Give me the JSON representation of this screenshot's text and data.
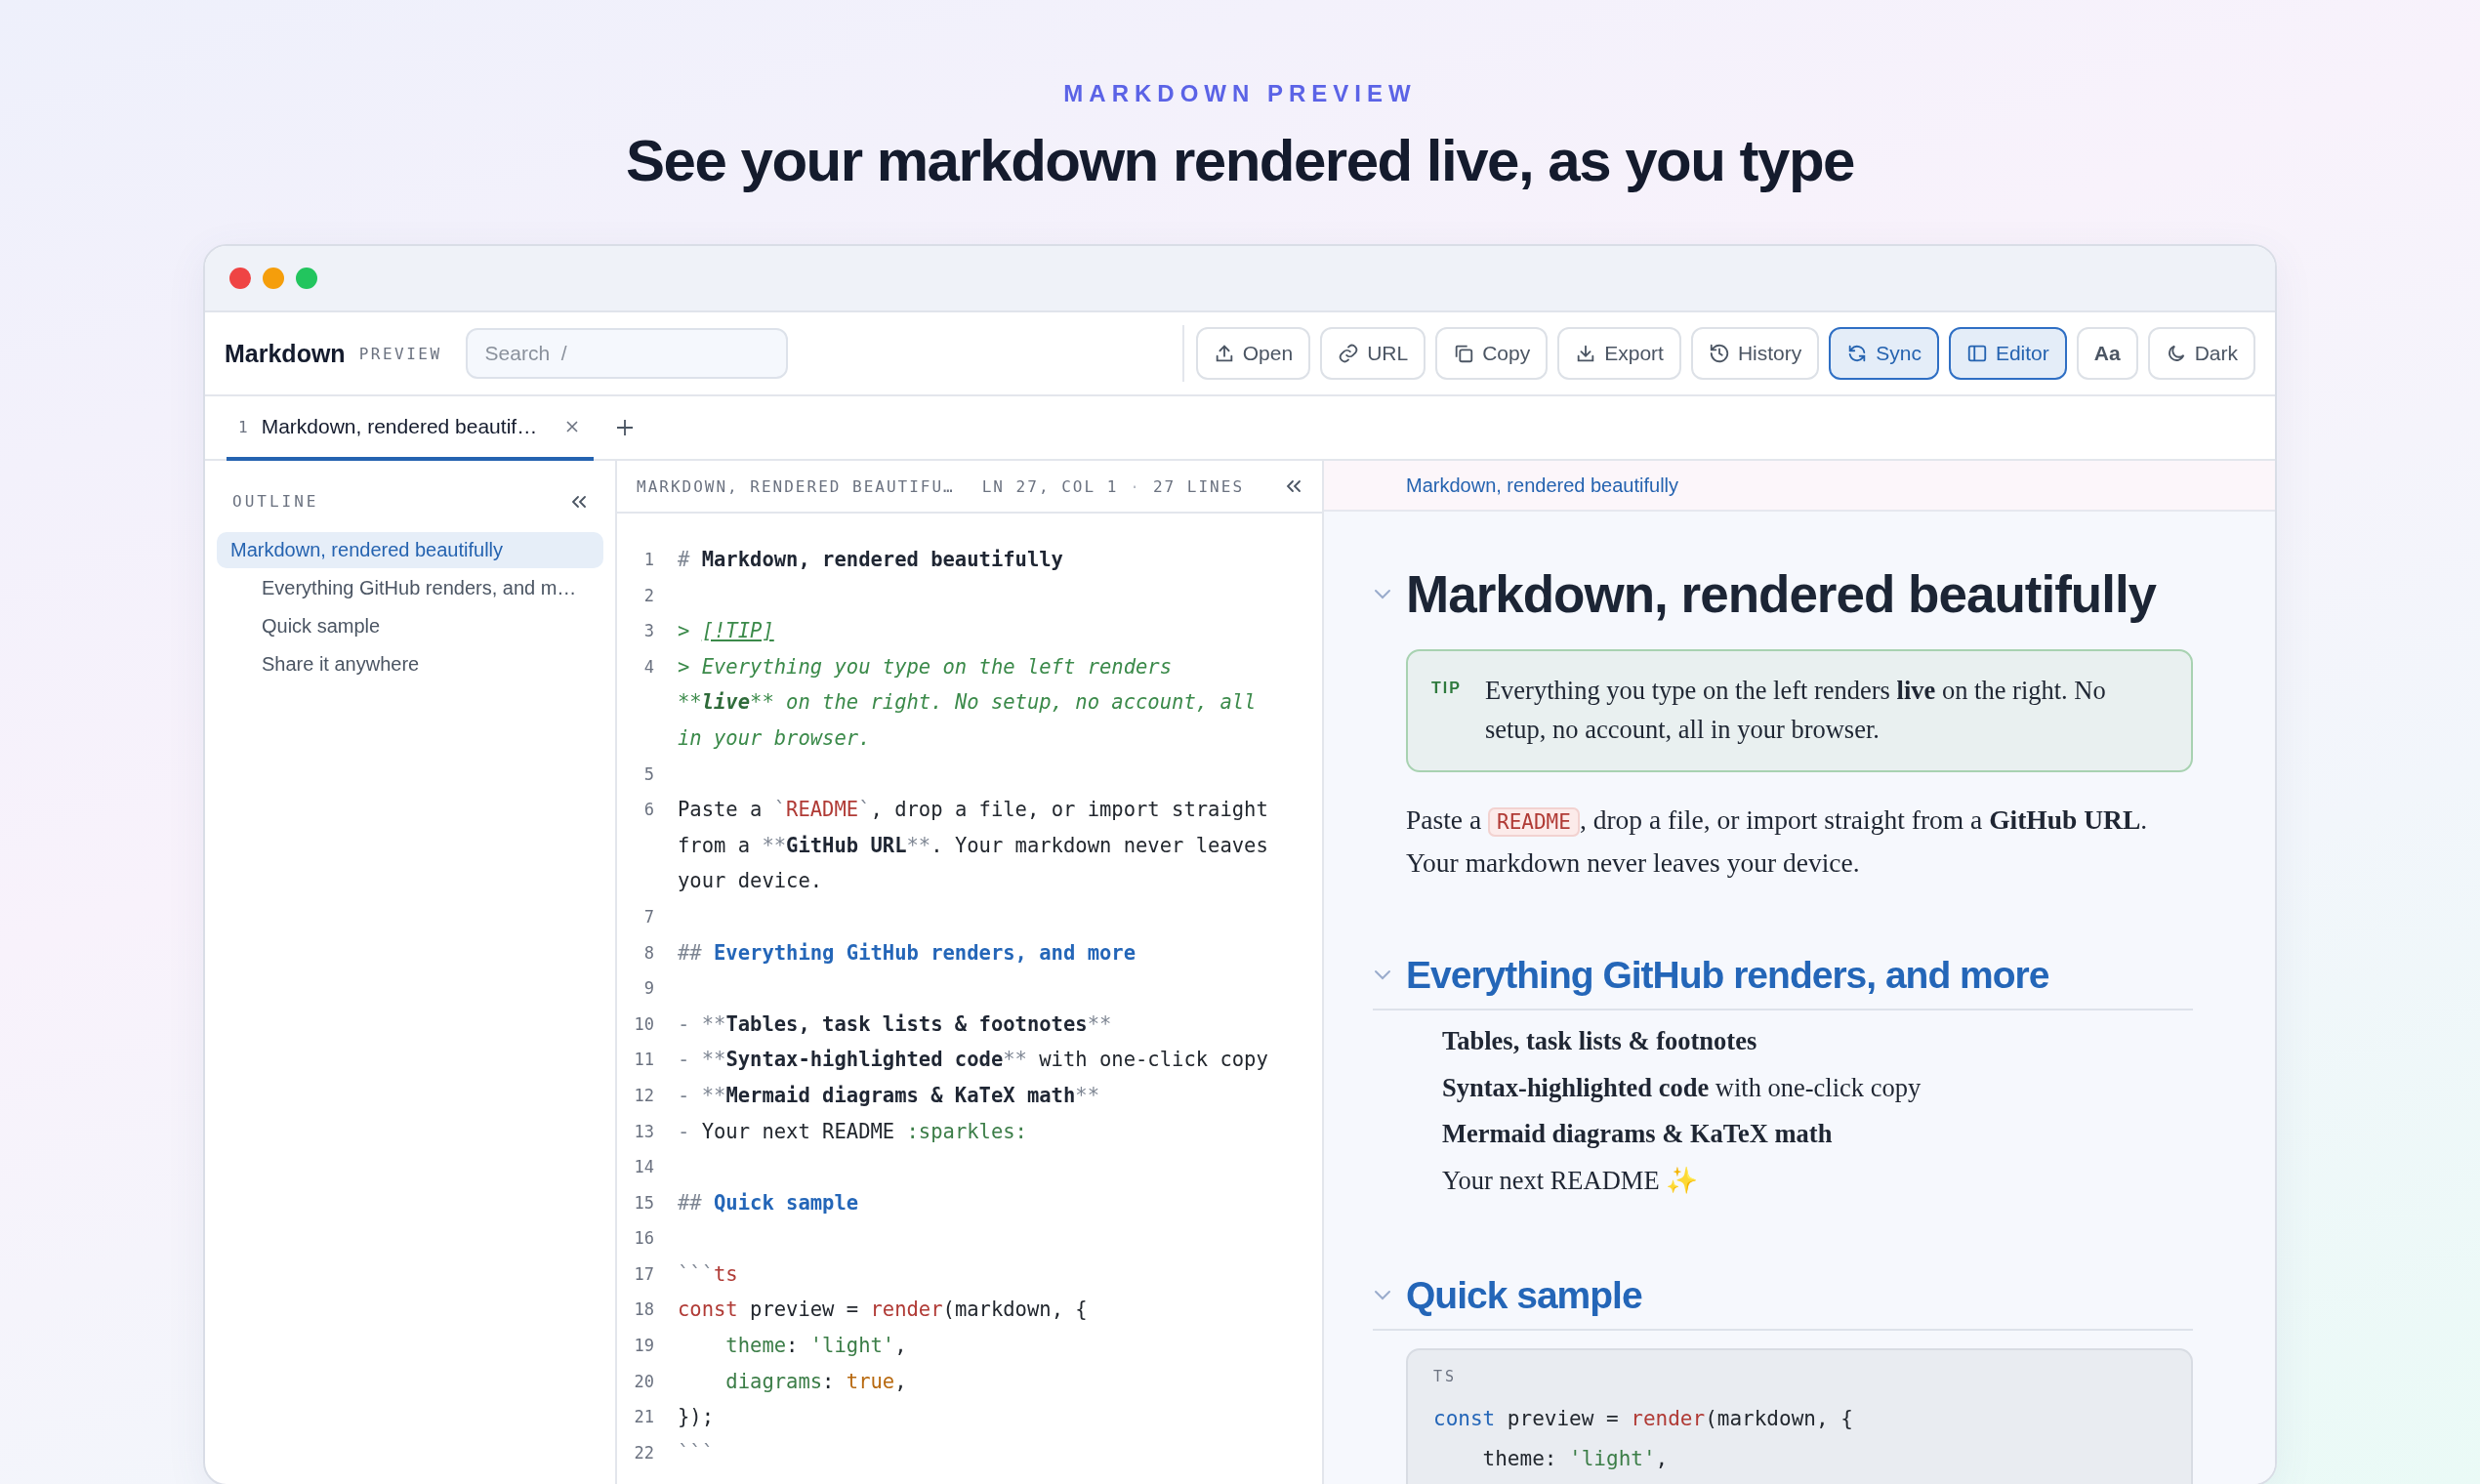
{
  "hero": {
    "eyebrow": "MARKDOWN PREVIEW",
    "headline": "See your markdown rendered live, as you type"
  },
  "toolbar": {
    "brand": "Markdown",
    "brand_tag": "PREVIEW",
    "search": {
      "placeholder": "Search  /"
    },
    "buttons": [
      {
        "label": "Open",
        "on": false
      },
      {
        "label": "URL",
        "on": false
      },
      {
        "label": "Copy",
        "on": false
      },
      {
        "label": "Export",
        "on": false
      },
      {
        "label": "History",
        "on": false
      },
      {
        "label": "Sync",
        "on": true
      },
      {
        "label": "Editor",
        "on": true
      },
      {
        "label": "Aa",
        "on": false
      },
      {
        "label": "Dark",
        "on": false
      }
    ]
  },
  "tabs": [
    {
      "number": "1",
      "title": "Markdown, rendered beautif…",
      "selected": true
    }
  ],
  "outline": {
    "title": "OUTLINE",
    "items": [
      {
        "label": "Markdown, rendered beautifully",
        "selected": true,
        "children": [
          {
            "label": "Everything GitHub renders, and m…",
            "selected": false
          },
          {
            "label": "Quick sample",
            "selected": false
          },
          {
            "label": "Share it anywhere",
            "selected": false
          }
        ]
      }
    ]
  },
  "editor": {
    "file": "MARKDOWN, RENDERED BEAUTIFU…",
    "position": "LN 27, COL 1",
    "separator": "·",
    "line_count": "27 LINES",
    "lines": [
      {
        "number": "1",
        "rows": [
          {
            "indented": false,
            "segments": [
              {
                "text": "# ",
                "kind": "marker"
              },
              {
                "text": "Markdown, rendered beautifully",
                "kind": "bold"
              }
            ]
          }
        ]
      },
      {
        "number": "2"
      },
      {
        "number": "3",
        "rows": [
          {
            "indented": false,
            "segments": [
              {
                "text": "> ",
                "kind": "quote"
              },
              {
                "text": "[!TIP]",
                "kind": "link"
              }
            ]
          }
        ]
      },
      {
        "number": "4",
        "rows": [
          {
            "indented": false,
            "segments": [
              {
                "text": "> Everything you type on the left renders",
                "kind": "quote"
              }
            ]
          },
          {
            "indented": false,
            "segments": [
              {
                "text": "**",
                "kind": "quote"
              },
              {
                "text": "live",
                "kind": "quote-bold"
              },
              {
                "text": "** on the right. No setup, no account, all",
                "kind": "quote"
              }
            ]
          },
          {
            "indented": false,
            "segments": [
              {
                "text": "in your browser.",
                "kind": "quote"
              }
            ]
          }
        ]
      },
      {
        "number": "5"
      },
      {
        "number": "6",
        "rows": [
          {
            "indented": false,
            "segments": [
              {
                "text": "Paste a ",
                "kind": "plain"
              },
              {
                "text": "`",
                "kind": "marker"
              },
              {
                "text": "README",
                "kind": "code"
              },
              {
                "text": "`",
                "kind": "marker"
              },
              {
                "text": ", drop a file, or import straight",
                "kind": "plain"
              }
            ]
          },
          {
            "indented": false,
            "segments": [
              {
                "text": "from a ",
                "kind": "plain"
              },
              {
                "text": "**",
                "kind": "marker"
              },
              {
                "text": "GitHub URL",
                "kind": "bold"
              },
              {
                "text": "**",
                "kind": "marker"
              },
              {
                "text": ". Your markdown never leaves",
                "kind": "plain"
              }
            ]
          },
          {
            "indented": false,
            "segments": [
              {
                "text": "your device.",
                "kind": "plain"
              }
            ]
          }
        ]
      },
      {
        "number": "7"
      },
      {
        "number": "8",
        "rows": [
          {
            "indented": false,
            "segments": [
              {
                "text": "## ",
                "kind": "marker"
              },
              {
                "text": "Everything GitHub renders, and more",
                "kind": "heading"
              }
            ]
          }
        ]
      },
      {
        "number": "9"
      },
      {
        "number": "10",
        "rows": [
          {
            "indented": false,
            "segments": [
              {
                "text": "- **",
                "kind": "marker"
              },
              {
                "text": "Tables, task lists & footnotes",
                "kind": "bold"
              },
              {
                "text": "**",
                "kind": "marker"
              }
            ]
          }
        ]
      },
      {
        "number": "11",
        "rows": [
          {
            "indented": false,
            "segments": [
              {
                "text": "- **",
                "kind": "marker"
              },
              {
                "text": "Syntax-highlighted code",
                "kind": "bold"
              },
              {
                "text": "**",
                "kind": "marker"
              },
              {
                "text": " with one-click copy",
                "kind": "plain"
              }
            ]
          }
        ]
      },
      {
        "number": "12",
        "rows": [
          {
            "indented": false,
            "segments": [
              {
                "text": "- **",
                "kind": "marker"
              },
              {
                "text": "Mermaid diagrams & KaTeX math",
                "kind": "bold"
              },
              {
                "text": "**",
                "kind": "marker"
              }
            ]
          }
        ]
      },
      {
        "number": "13",
        "rows": [
          {
            "indented": false,
            "segments": [
              {
                "text": "- ",
                "kind": "marker"
              },
              {
                "text": "Your next README ",
                "kind": "plain"
              },
              {
                "text": ":sparkles:",
                "kind": "emoji"
              }
            ]
          }
        ]
      },
      {
        "number": "14"
      },
      {
        "number": "15",
        "rows": [
          {
            "indented": false,
            "segments": [
              {
                "text": "## ",
                "kind": "marker"
              },
              {
                "text": "Quick sample",
                "kind": "heading"
              }
            ]
          }
        ]
      },
      {
        "number": "16"
      },
      {
        "number": "17",
        "rows": [
          {
            "indented": false,
            "segments": [
              {
                "text": "```",
                "kind": "marker"
              },
              {
                "text": "ts",
                "kind": "code"
              }
            ]
          }
        ]
      },
      {
        "number": "18",
        "rows": [
          {
            "indented": false,
            "segments": [
              {
                "text": "const",
                "kind": "keyword"
              },
              {
                "text": " preview = ",
                "kind": "plain"
              },
              {
                "text": "render",
                "kind": "func"
              },
              {
                "text": "(markdown, {",
                "kind": "plain"
              }
            ]
          }
        ]
      },
      {
        "number": "19",
        "rows": [
          {
            "indented": true,
            "segments": [
              {
                "text": "theme",
                "kind": "key"
              },
              {
                "text": ": ",
                "kind": "plain"
              },
              {
                "text": "'light'",
                "kind": "string"
              },
              {
                "text": ",",
                "kind": "plain"
              }
            ]
          }
        ]
      },
      {
        "number": "20",
        "rows": [
          {
            "indented": true,
            "segments": [
              {
                "text": "diagrams",
                "kind": "key"
              },
              {
                "text": ": ",
                "kind": "plain"
              },
              {
                "text": "true",
                "kind": "bool"
              },
              {
                "text": ",",
                "kind": "plain"
              }
            ]
          }
        ]
      },
      {
        "number": "21",
        "rows": [
          {
            "indented": false,
            "segments": [
              {
                "text": "});",
                "kind": "plain"
              }
            ]
          }
        ]
      },
      {
        "number": "22",
        "rows": [
          {
            "indented": false,
            "segments": [
              {
                "text": "```",
                "kind": "marker"
              }
            ]
          }
        ]
      }
    ]
  },
  "preview": {
    "breadcrumb": "Markdown, rendered beautifully",
    "blocks": [
      {
        "kind": "title",
        "text": "Markdown, rendered beautifully"
      },
      {
        "kind": "callout",
        "label": "TIP",
        "text": "Everything you type on the left renders **live** on the right. No setup, no account, all in your browser."
      },
      {
        "kind": "paragraph",
        "segments": [
          {
            "text": "Paste a ",
            "kind": "plain"
          },
          {
            "text": "README",
            "kind": "code"
          },
          {
            "text": ", drop a file, or import straight from a ",
            "kind": "plain"
          },
          {
            "text": "GitHub URL",
            "kind": "bold"
          },
          {
            "text": ". Your markdown never leaves your device.",
            "kind": "plain"
          }
        ]
      },
      {
        "kind": "heading",
        "text": "Everything GitHub renders, and more"
      },
      {
        "kind": "list",
        "items": [
          {
            "text": "**Tables, task lists & footnotes**"
          },
          {
            "text": "**Syntax-highlighted code** with one-click copy"
          },
          {
            "text": "**Mermaid diagrams & KaTeX math**"
          },
          {
            "text": "Your next README ✨"
          }
        ]
      },
      {
        "kind": "heading",
        "text": "Quick sample"
      },
      {
        "kind": "code",
        "language": "TS",
        "rows": [
          {
            "indented": false,
            "segments": [
              {
                "text": "const",
                "kind": "keyword"
              },
              {
                "text": " preview = ",
                "kind": "plain"
              },
              {
                "text": "render",
                "kind": "func"
              },
              {
                "text": "(markdown, {",
                "kind": "plain"
              }
            ]
          },
          {
            "indented": true,
            "segments": [
              {
                "text": "theme",
                "kind": "plain"
              },
              {
                "text": ": ",
                "kind": "plain"
              },
              {
                "text": "'light'",
                "kind": "string"
              },
              {
                "text": ",",
                "kind": "plain"
              }
            ]
          }
        ]
      }
    ]
  }
}
